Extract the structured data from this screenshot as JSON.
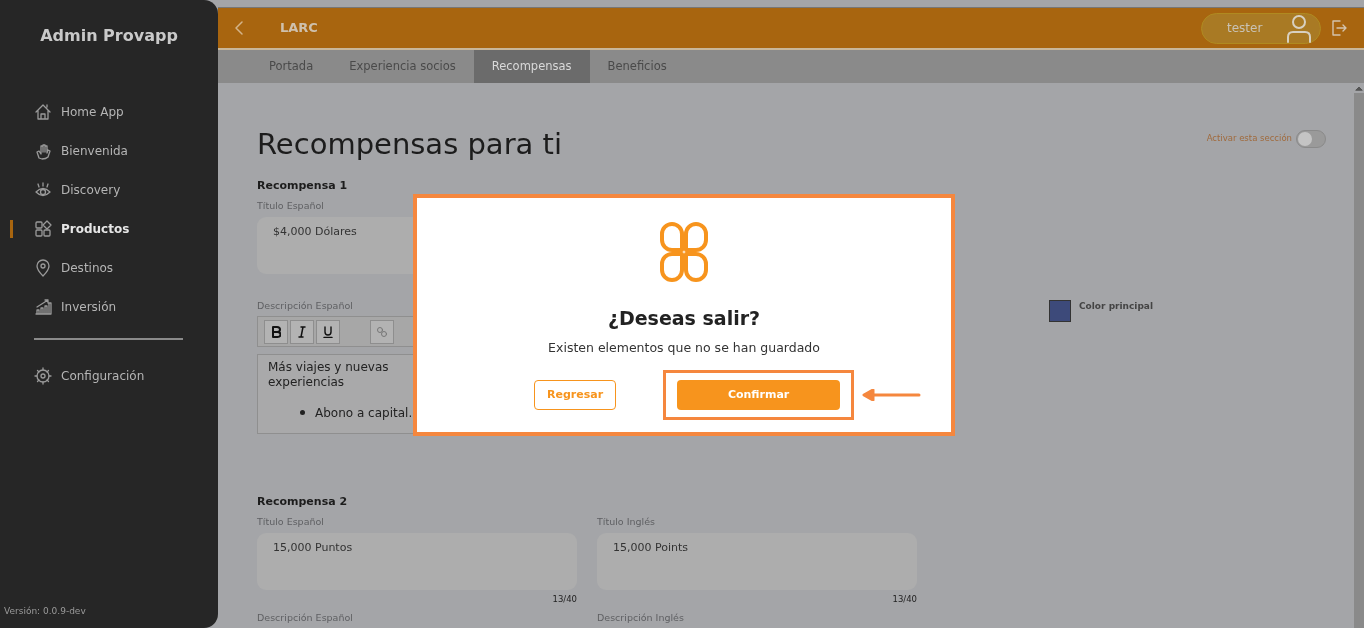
{
  "sidebar": {
    "title": "Admin Provapp",
    "items": [
      {
        "label": "Home App",
        "selected": false
      },
      {
        "label": "Bienvenida",
        "selected": false
      },
      {
        "label": "Discovery",
        "selected": false
      },
      {
        "label": "Productos",
        "selected": true
      },
      {
        "label": "Destinos",
        "selected": false
      },
      {
        "label": "Inversión",
        "selected": false
      }
    ],
    "footer_items": [
      {
        "label": "Configuración",
        "selected": false
      }
    ],
    "version": "Versión: 0.0.9-dev"
  },
  "header": {
    "title": "LARC",
    "user": "tester"
  },
  "tabs": [
    {
      "label": "Portada",
      "selected": false
    },
    {
      "label": "Experiencia socios",
      "selected": false
    },
    {
      "label": "Recompensas",
      "selected": true
    },
    {
      "label": "Beneficios",
      "selected": false
    }
  ],
  "page": {
    "title": "Recompensas para ti",
    "toggle": {
      "label": "Activar esta sección",
      "on": false
    }
  },
  "rewards": [
    {
      "heading": "Recompensa 1",
      "fields": [
        {
          "label": "Título Español",
          "value": "$4,000 Dólares"
        }
      ],
      "descriptions": [
        {
          "label": "Descripción Español",
          "paragraph": "Más viajes y nuevas experiencias",
          "bullets": [
            "Abono a capital."
          ]
        }
      ],
      "color": {
        "label": "Color principal",
        "color": "#3d4a7a"
      }
    },
    {
      "heading": "Recompensa 2",
      "fields": [
        {
          "label": "Título Español",
          "value": "15,000 Puntos",
          "counter": "13/40"
        },
        {
          "label": "Título Inglés",
          "value": "15,000 Points",
          "counter": "13/40"
        }
      ],
      "descriptions": [
        {
          "label": "Descripción Español"
        },
        {
          "label": "Descripción Inglés"
        }
      ]
    }
  ],
  "dialog": {
    "title": "¿Deseas salir?",
    "message": "Existen elementos que no se han guardado",
    "buttons": [
      {
        "label": "Regresar",
        "kind": "outline",
        "highlighted": false
      },
      {
        "label": "Confirmar",
        "kind": "primary",
        "highlighted": true
      }
    ]
  }
}
